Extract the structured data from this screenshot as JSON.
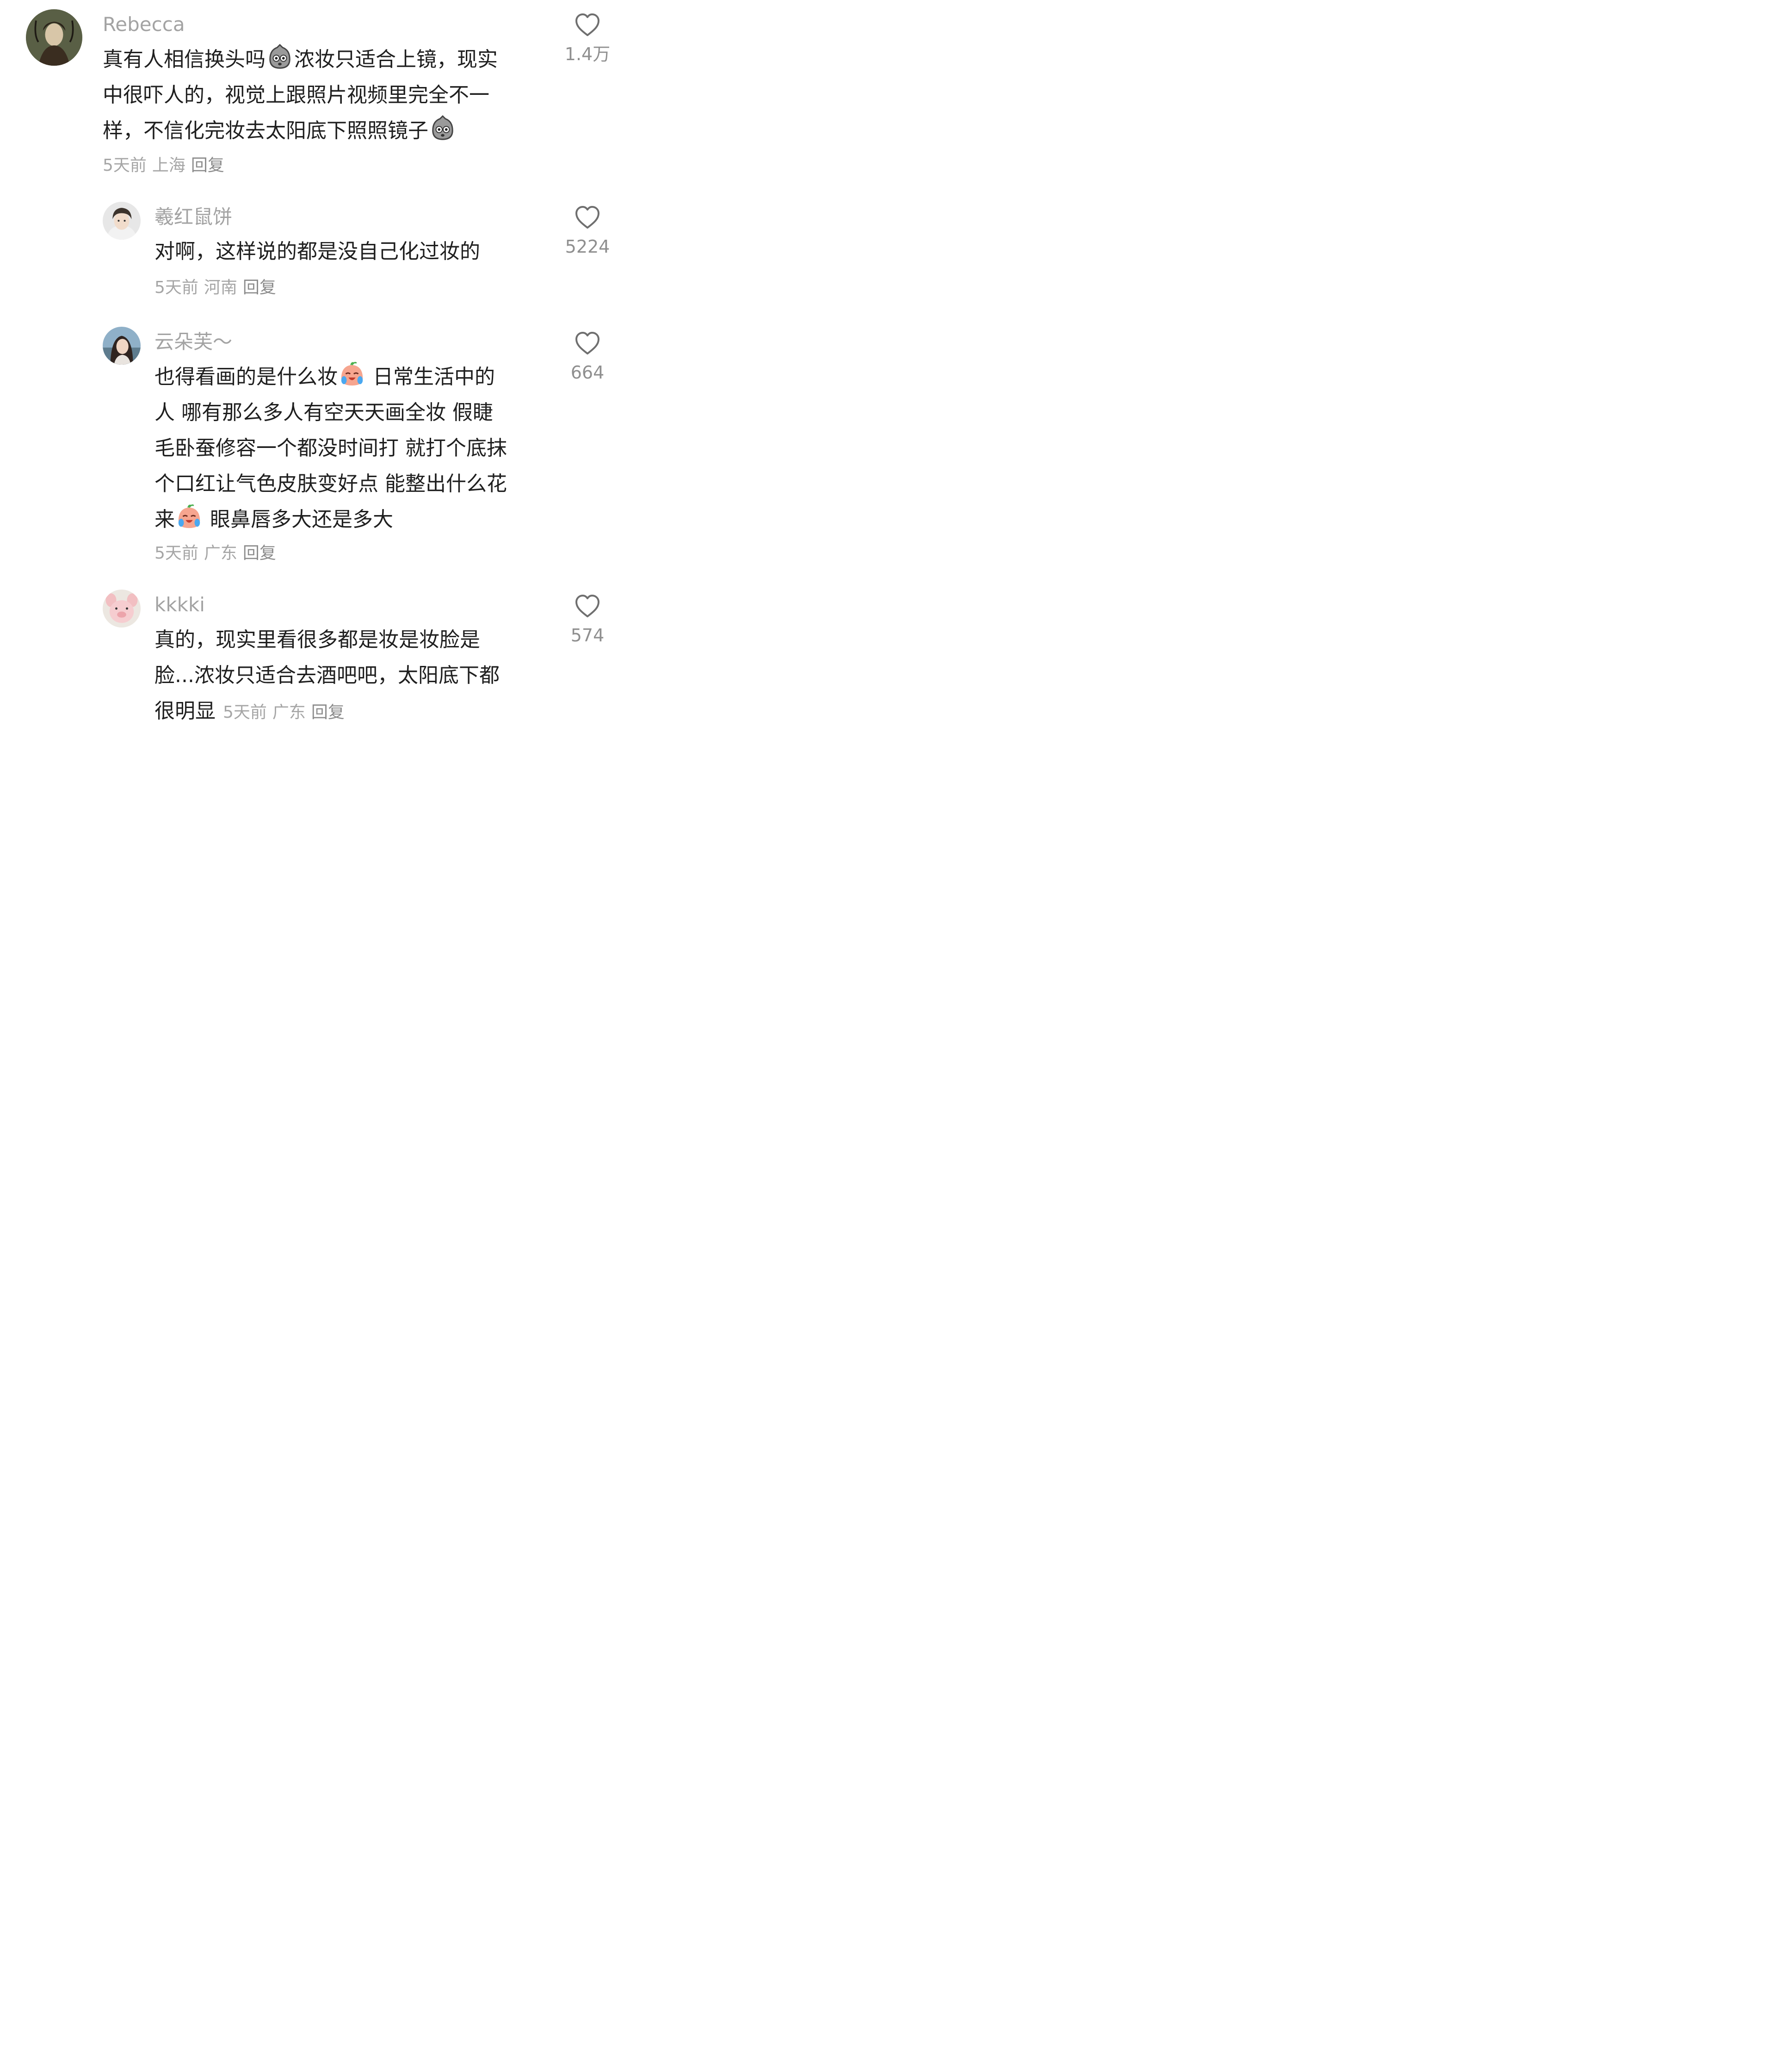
{
  "comments": [
    {
      "username": "Rebecca",
      "avatar": "avatar-portrait-icon",
      "lines": [
        {
          "a": "真有人相信换头吗",
          "emoji": "shocked-face-emoji",
          "b": "浓妆只适合上镜，现实"
        },
        {
          "a": "中很吓人的，视觉上跟照片视频里完全不一",
          "emoji": null,
          "b": ""
        },
        {
          "a": "样，不信化完妆去太阳底下照照镜子",
          "emoji": "shocked-face-emoji",
          "b": ""
        }
      ],
      "time": "5天前",
      "location": "上海",
      "reply": "回复",
      "likes": "1.4万"
    },
    {
      "username": "羲红鼠饼",
      "avatar": "avatar-person-icon",
      "lines": [
        {
          "a": "对啊，这样说的都是没自己化过妆的",
          "emoji": null,
          "b": ""
        }
      ],
      "time": "5天前",
      "location": "河南",
      "reply": "回复",
      "likes": "5224"
    },
    {
      "username": "云朵芙～",
      "avatar": "avatar-girl-icon",
      "lines": [
        {
          "a": "也得看画的是什么妆",
          "emoji": "crying-laugh-emoji",
          "b": " 日常生活中的"
        },
        {
          "a": "人 哪有那么多人有空天天画全妆 假睫",
          "emoji": null,
          "b": ""
        },
        {
          "a": "毛卧蚕修容一个都没时间打 就打个底抹",
          "emoji": null,
          "b": ""
        },
        {
          "a": "个口红让气色皮肤变好点 能整出什么花",
          "emoji": null,
          "b": ""
        },
        {
          "a": "来",
          "emoji": "crying-laugh-emoji",
          "b": " 眼鼻唇多大还是多大"
        }
      ],
      "time": "5天前",
      "location": "广东",
      "reply": "回复",
      "likes": "664"
    },
    {
      "username": "kkkki",
      "avatar": "avatar-pig-toy-icon",
      "lines": [
        {
          "a": "真的，现实里看很多都是妆是妆脸是",
          "emoji": null,
          "b": ""
        },
        {
          "a": "脸...浓妆只适合去酒吧吧，太阳底下都",
          "emoji": null,
          "b": ""
        },
        {
          "a": "很明显",
          "emoji": null,
          "b": ""
        }
      ],
      "time": "5天前",
      "location": "广东",
      "reply": "回复",
      "likes": "574"
    }
  ]
}
